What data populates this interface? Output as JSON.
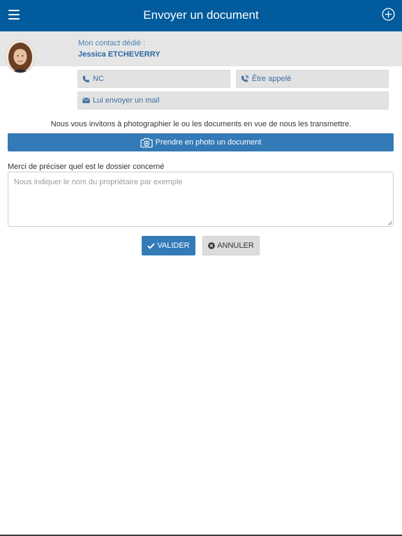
{
  "header": {
    "title": "Envoyer un document"
  },
  "contact": {
    "label": "Mon contact dédié :",
    "name": "Jessica ETCHEVERRY"
  },
  "actions": {
    "phone_label": "NC",
    "callback_label": "Être appelé",
    "mail_label": "Lui envoyer un mail"
  },
  "main": {
    "invite_text": "Nous vous invitons à photographier le ou les documents en vue de nous les transmettre.",
    "photo_button_label": "Prendre en photo un document",
    "dossier_label": "Merci de préciser quel est le dossier concerné",
    "dossier_placeholder": "Nous indiquer le nom du propriétaire par exemple",
    "dossier_value": ""
  },
  "buttons": {
    "validate_label": "VALIDER",
    "cancel_label": "ANNULER"
  },
  "icons": {
    "menu": "hamburger-menu-icon",
    "add": "plus-circle-icon",
    "phone": "phone-icon",
    "callback": "phone-callback-icon",
    "mail": "envelope-icon",
    "camera": "camera-icon",
    "check": "check-icon",
    "cancel": "times-circle-icon"
  },
  "colors": {
    "header": "#015b9c",
    "primary_button": "#337ab7",
    "link_text": "#3d6fa2",
    "grey_button": "#e2e2e2"
  }
}
